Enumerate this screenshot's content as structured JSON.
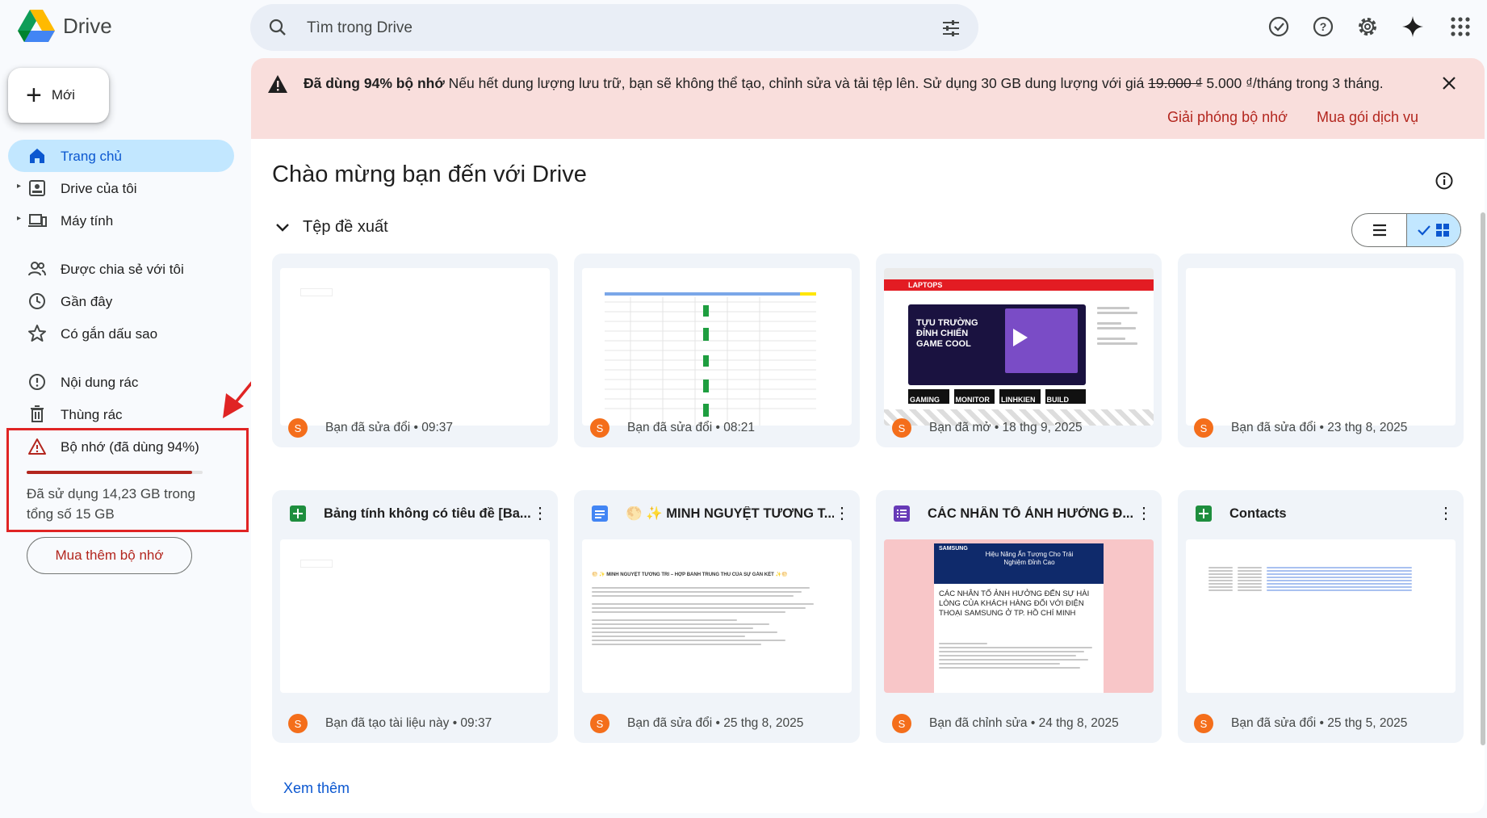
{
  "app": {
    "name": "Drive"
  },
  "search": {
    "placeholder": "Tìm trong Drive"
  },
  "sidebar": {
    "new_label": "Mới",
    "items": [
      {
        "label": "Trang chủ",
        "icon": "home-icon",
        "active": true
      },
      {
        "label": "Drive của tôi",
        "icon": "my-drive-icon"
      },
      {
        "label": "Máy tính",
        "icon": "computers-icon"
      },
      {
        "label": "Được chia sẻ với tôi",
        "icon": "shared-icon"
      },
      {
        "label": "Gần đây",
        "icon": "clock-icon"
      },
      {
        "label": "Có gắn dấu sao",
        "icon": "star-icon"
      },
      {
        "label": "Nội dung rác",
        "icon": "spam-icon"
      },
      {
        "label": "Thùng rác",
        "icon": "trash-icon"
      },
      {
        "label": "Bộ nhớ (đã dùng 94%)",
        "icon": "warning-icon"
      }
    ],
    "storage": {
      "used_fraction": 0.94,
      "text": "Đã sử dụng 14,23 GB trong tổng số 15 GB",
      "buy_label": "Mua thêm bộ nhớ"
    }
  },
  "banner": {
    "bold": "Đã dùng 94% bộ nhớ",
    "text": " Nếu hết dung lượng lưu trữ, bạn sẽ không thể tạo, chỉnh sửa và tải tệp lên. Sử dụng 30 GB dung lượng với giá ",
    "old_price": "19.000 ₫",
    "new_price": " 5.000 ₫/tháng trong 3 tháng.",
    "link_free": "Giải phóng bộ nhớ",
    "link_buy": "Mua gói dịch vụ"
  },
  "main": {
    "welcome": "Chào mừng bạn đến với Drive",
    "section": "Tệp đề xuất",
    "see_more": "Xem thêm"
  },
  "cards": [
    {
      "title": "",
      "meta": "Bạn đã sửa đổi • 09:37",
      "avatar": "S"
    },
    {
      "title": "",
      "meta": "Bạn đã sửa đổi • 08:21",
      "avatar": "S"
    },
    {
      "title": "",
      "meta": "Bạn đã mở • 18 thg 9, 2025",
      "avatar": "S"
    },
    {
      "title": "",
      "meta": "Bạn đã sửa đổi • 23 thg 8, 2025",
      "avatar": "S"
    },
    {
      "title": "Bảng tính không có tiêu đề [Ba...",
      "meta": "Bạn đã tạo tài liệu này • 09:37",
      "avatar": "S",
      "type": "sheets"
    },
    {
      "title": "🌕 ✨ MINH NGUYỆT TƯƠNG T...",
      "meta": "Bạn đã sửa đổi • 25 thg 8, 2025",
      "avatar": "S",
      "type": "docs"
    },
    {
      "title": "CÁC NHÂN TỐ ẢNH HƯỞNG Đ...",
      "meta": "Bạn đã chỉnh sửa • 24 thg 8, 2025",
      "avatar": "S",
      "type": "forms"
    },
    {
      "title": "Contacts",
      "meta": "Bạn đã sửa đổi • 25 thg 5, 2025",
      "avatar": "S",
      "type": "sheets"
    }
  ],
  "thumbs": {
    "laptop_brand": "LAPTOPS",
    "laptop_banner": "TỰU TRƯỜNG ĐỈNH CHIẾN GAME COOL",
    "laptop_tiles": [
      "GAMING",
      "MONITOR",
      "LINHKIEN",
      "BUILD"
    ],
    "doc_heading": "🌕 ✨ MINH NGUYỆT TƯƠNG TRI – HỢP BÁNH TRUNG THU CỦA SỰ GẮN KẾT ✨🌕",
    "form_brand": "SAMSUNG",
    "form_banner": "Hiệu Năng Ấn Tượng Cho Trải Nghiệm Đỉnh Cao",
    "form_title": "CÁC NHÂN TỐ ẢNH HƯỞNG ĐẾN SỰ HÀI LÒNG CỦA KHÁCH HÀNG ĐỐI VỚI ĐIỆN THOẠI SAMSUNG Ở TP. HỒ CHÍ MINH"
  },
  "colors": {
    "accent": "#0b57d0",
    "warning": "#b3261e",
    "banner_bg": "#f9dedc",
    "avatar": "#f46e1b"
  }
}
